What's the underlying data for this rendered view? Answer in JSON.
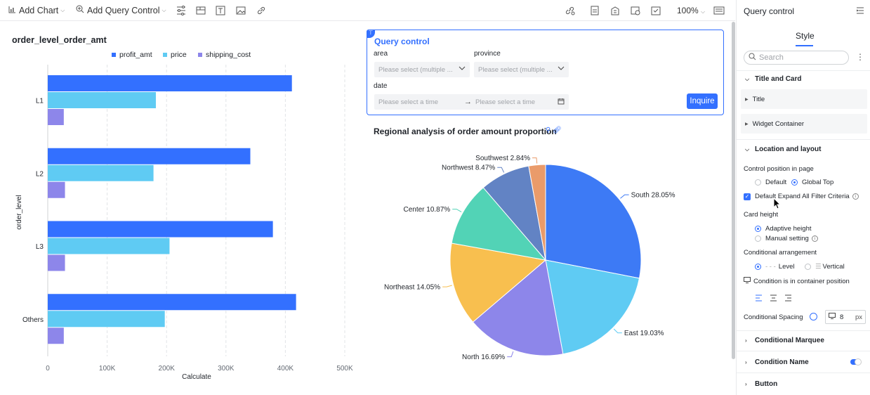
{
  "toolbar": {
    "add_chart": "Add Chart",
    "add_query_control": "Add Query Control",
    "zoom": "100%"
  },
  "bar_chart": {
    "title": "order_level_order_amt",
    "legend": [
      {
        "name": "profit_amt",
        "color": "#3370ff"
      },
      {
        "name": "price",
        "color": "#5fcbf3"
      },
      {
        "name": "shipping_cost",
        "color": "#8d86ea"
      }
    ],
    "ylabel": "order_level",
    "xlabel": "Calculate",
    "x_ticks": [
      "0",
      "100K",
      "200K",
      "300K",
      "400K",
      "500K"
    ]
  },
  "query_control": {
    "title": "Query control",
    "area_label": "area",
    "province_label": "province",
    "date_label": "date",
    "area_placeholder": "Please select (multiple ...",
    "province_placeholder": "Please select (multiple ...",
    "start_time_placeholder": "Please select a time",
    "end_time_placeholder": "Please select a time",
    "button": "Inquire"
  },
  "pie_chart": {
    "title": "Regional analysis of order amount proportion"
  },
  "chart_data": [
    {
      "type": "bar",
      "orientation": "horizontal",
      "title": "order_level_order_amt",
      "categories": [
        "L1",
        "L2",
        "L3",
        "Others"
      ],
      "series": [
        {
          "name": "profit_amt",
          "values": [
            411000,
            341000,
            379000,
            418000
          ]
        },
        {
          "name": "price",
          "values": [
            182000,
            178000,
            205000,
            197000
          ]
        },
        {
          "name": "shipping_cost",
          "values": [
            27000,
            29000,
            29000,
            27000
          ]
        }
      ],
      "xlabel": "Calculate",
      "ylabel": "order_level",
      "xlim": [
        0,
        500000
      ],
      "grid": true,
      "legend": "top"
    },
    {
      "type": "pie",
      "title": "Regional analysis of order amount proportion",
      "slices": [
        {
          "label": "South",
          "value": 28.05,
          "text": "South 28.05%",
          "color": "#3d7af5"
        },
        {
          "label": "East",
          "value": 19.03,
          "text": "East 19.03%",
          "color": "#5fcbf3"
        },
        {
          "label": "North",
          "value": 16.69,
          "text": "North 16.69%",
          "color": "#8d86ea"
        },
        {
          "label": "Northeast",
          "value": 14.05,
          "text": "Northeast 14.05%",
          "color": "#f8bf4f"
        },
        {
          "label": "Center",
          "value": 10.87,
          "text": "Center 10.87%",
          "color": "#52d3b6"
        },
        {
          "label": "Northwest",
          "value": 8.47,
          "text": "Northwest 8.47%",
          "color": "#6283c4"
        },
        {
          "label": "Southwest",
          "value": 2.84,
          "text": "Southwest 2.84%",
          "color": "#ea9b6a"
        }
      ]
    }
  ],
  "panel": {
    "title": "Query control",
    "tab": "Style",
    "search_placeholder": "Search",
    "title_and_card": "Title and Card",
    "title_item": "Title",
    "widget_container": "Widget Container",
    "location_layout": "Location and layout",
    "control_position": "Control position in page",
    "opt_default": "Default",
    "opt_global_top": "Global Top",
    "default_expand": "Default Expand All Filter Criteria",
    "card_height": "Card height",
    "adaptive_height": "Adaptive height",
    "manual_setting": "Manual setting",
    "conditional_arrangement": "Conditional arrangement",
    "level": "Level",
    "vertical": "Vertical",
    "container_position": "Condition is in container position",
    "conditional_spacing": "Conditional Spacing",
    "spacing_value": "8",
    "spacing_unit": "px",
    "conditional_marquee": "Conditional Marquee",
    "condition_name": "Condition Name",
    "button": "Button"
  }
}
